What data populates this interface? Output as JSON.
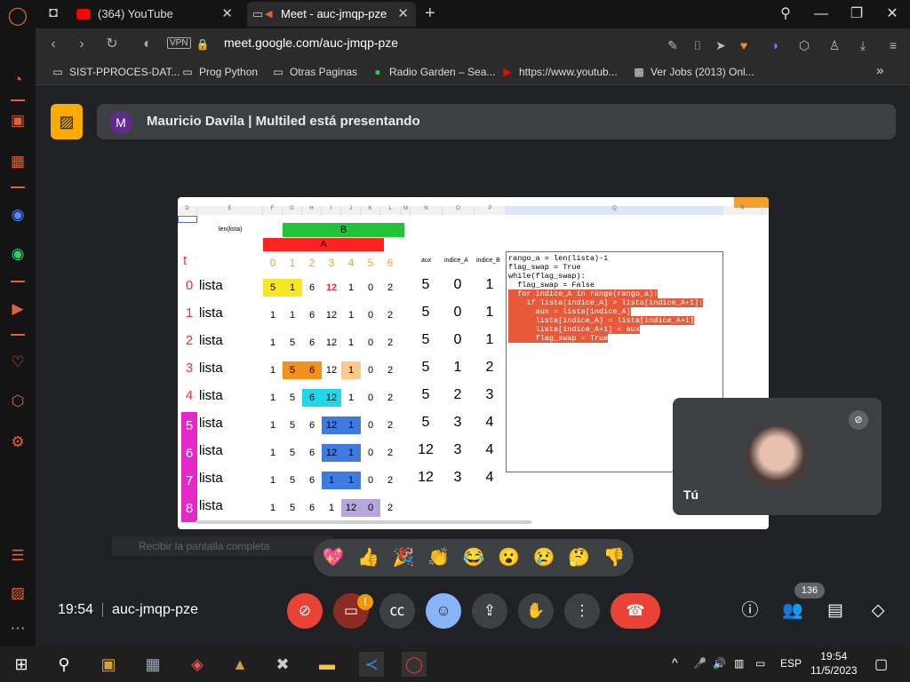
{
  "tabs": [
    {
      "label": "(364) YouTube"
    },
    {
      "label": "Meet - auc-jmqp-pze"
    }
  ],
  "addressbar": {
    "vpn": "VPN",
    "url": "meet.google.com/auc-jmqp-pze"
  },
  "bookmarks": [
    "SIST-PPROCES-DAT...",
    "Prog Python",
    "Otras Paginas",
    "Radio Garden – Sea...",
    "https://www.youtub...",
    "Ver Jobs (2013) Onl..."
  ],
  "presenter": {
    "initial": "M",
    "text": "Mauricio Davila | Multiled está presentando"
  },
  "sheet": {
    "col_letters": [
      "D",
      "E",
      "F",
      "G",
      "H",
      "I",
      "J",
      "K",
      "L",
      "M",
      "N",
      "O",
      "P",
      "Q",
      "R"
    ],
    "len_label": "len(lista)",
    "b_label": "B",
    "a_label": "A",
    "t_label": "t",
    "index_header": [
      "0",
      "1",
      "2",
      "3",
      "4",
      "5",
      "6"
    ],
    "aux_header": "aux",
    "indiceA_header": "indice_A",
    "indiceB_header": "indice_B",
    "rows": [
      {
        "t": "0",
        "label": "lista",
        "vals": [
          "5",
          "1",
          "6",
          "12",
          "1",
          "0",
          "2"
        ],
        "aux": "5",
        "a": "0",
        "b": "1"
      },
      {
        "t": "1",
        "label": "lista",
        "vals": [
          "1",
          "1",
          "6",
          "12",
          "1",
          "0",
          "2"
        ],
        "aux": "5",
        "a": "0",
        "b": "1"
      },
      {
        "t": "2",
        "label": "lista",
        "vals": [
          "1",
          "5",
          "6",
          "12",
          "1",
          "0",
          "2"
        ],
        "aux": "5",
        "a": "0",
        "b": "1"
      },
      {
        "t": "3",
        "label": "lista",
        "vals": [
          "1",
          "5",
          "6",
          "12",
          "1",
          "0",
          "2"
        ],
        "aux": "5",
        "a": "1",
        "b": "2"
      },
      {
        "t": "4",
        "label": "lista",
        "vals": [
          "1",
          "5",
          "6",
          "12",
          "1",
          "0",
          "2"
        ],
        "aux": "5",
        "a": "2",
        "b": "3"
      },
      {
        "t": "5",
        "label": "lista",
        "vals": [
          "1",
          "5",
          "6",
          "12",
          "1",
          "0",
          "2"
        ],
        "aux": "5",
        "a": "3",
        "b": "4"
      },
      {
        "t": "6",
        "label": "lista",
        "vals": [
          "1",
          "5",
          "6",
          "12",
          "1",
          "0",
          "2"
        ],
        "aux": "12",
        "a": "3",
        "b": "4"
      },
      {
        "t": "7",
        "label": "lista",
        "vals": [
          "1",
          "5",
          "6",
          "1",
          "1",
          "0",
          "2"
        ],
        "aux": "12",
        "a": "3",
        "b": "4"
      },
      {
        "t": "8",
        "label": "lista",
        "vals": [
          "1",
          "5",
          "6",
          "1",
          "12",
          "0",
          "2"
        ],
        "aux": "",
        "a": "",
        "b": ""
      }
    ],
    "code": [
      "rango_a = len(lista)-1",
      "flag_swap = True",
      "",
      "while(flag_swap):",
      "  flag_swap = False",
      "  for indice_A in range(rango_a):",
      "    if lista[indice_A] > lista[indice_A+1]:",
      "      aux = lista[indice_A]",
      "      lista[indice_A] = lista[indice_A+1]",
      "      lista[indice_A+1] = aux",
      "      flag_swap = True"
    ]
  },
  "self_tile": {
    "label": "Tú"
  },
  "caption_hint": "Recibir la pantalla completa",
  "reactions": [
    "💖",
    "👍",
    "🎉",
    "👏",
    "😂",
    "😮",
    "😢",
    "🤔",
    "👎"
  ],
  "bottombar": {
    "time": "19:54",
    "code": "auc-jmqp-pze",
    "people_count": "136"
  },
  "taskbar": {
    "lang": "ESP",
    "time": "19:54",
    "date": "11/5/2023"
  }
}
